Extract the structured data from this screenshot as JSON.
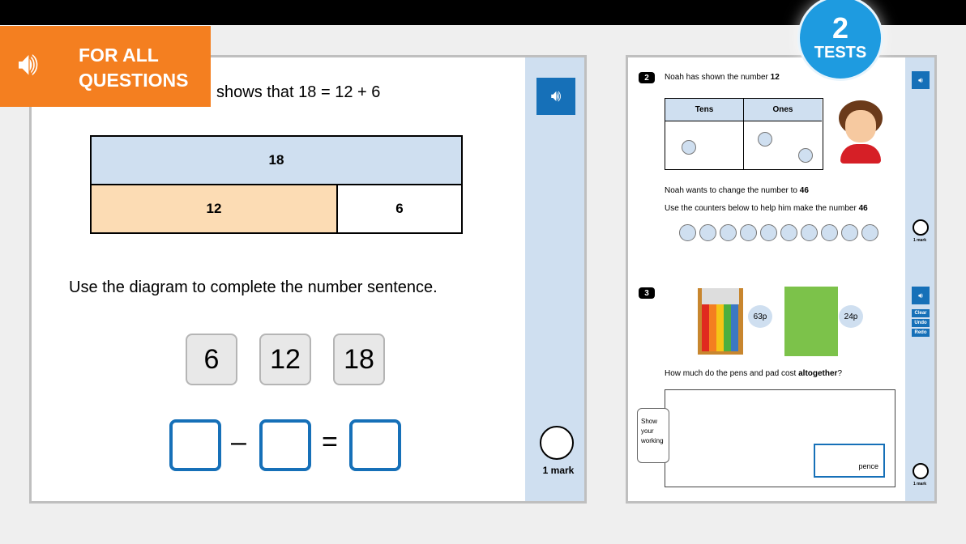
{
  "banner": {
    "line1": "FOR ALL",
    "line2": "QUESTIONS",
    "color": "#f47f20"
  },
  "badge": {
    "number": "2",
    "label": "TESTS",
    "color": "#1e9be0"
  },
  "left": {
    "statement": "shows that 18 = 12 + 6",
    "bar": {
      "whole": "18",
      "part1": "12",
      "part2": "6"
    },
    "instruction": "Use the diagram to complete the number sentence.",
    "tiles": [
      "6",
      "12",
      "18"
    ],
    "minus": "–",
    "equals": "=",
    "mark": "1 mark"
  },
  "right": {
    "q2": {
      "number": "2",
      "text": "Noah has shown the number ",
      "num": "12",
      "headers": [
        "Tens",
        "Ones"
      ],
      "line2": "Noah wants to change the number to ",
      "num2": "46",
      "line3": "Use the counters below to help him make the number ",
      "num3": "46",
      "mark": "1 mark"
    },
    "q3": {
      "number": "3",
      "price1": "63p",
      "price2": "24p",
      "question": "How much do the pens and pad cost ",
      "bold": "altogether",
      "q_end": "?",
      "working": "Show your working",
      "unit": "pence",
      "mark": "1 mark"
    },
    "buttons": [
      "Clear",
      "Undo",
      "Redo"
    ]
  }
}
